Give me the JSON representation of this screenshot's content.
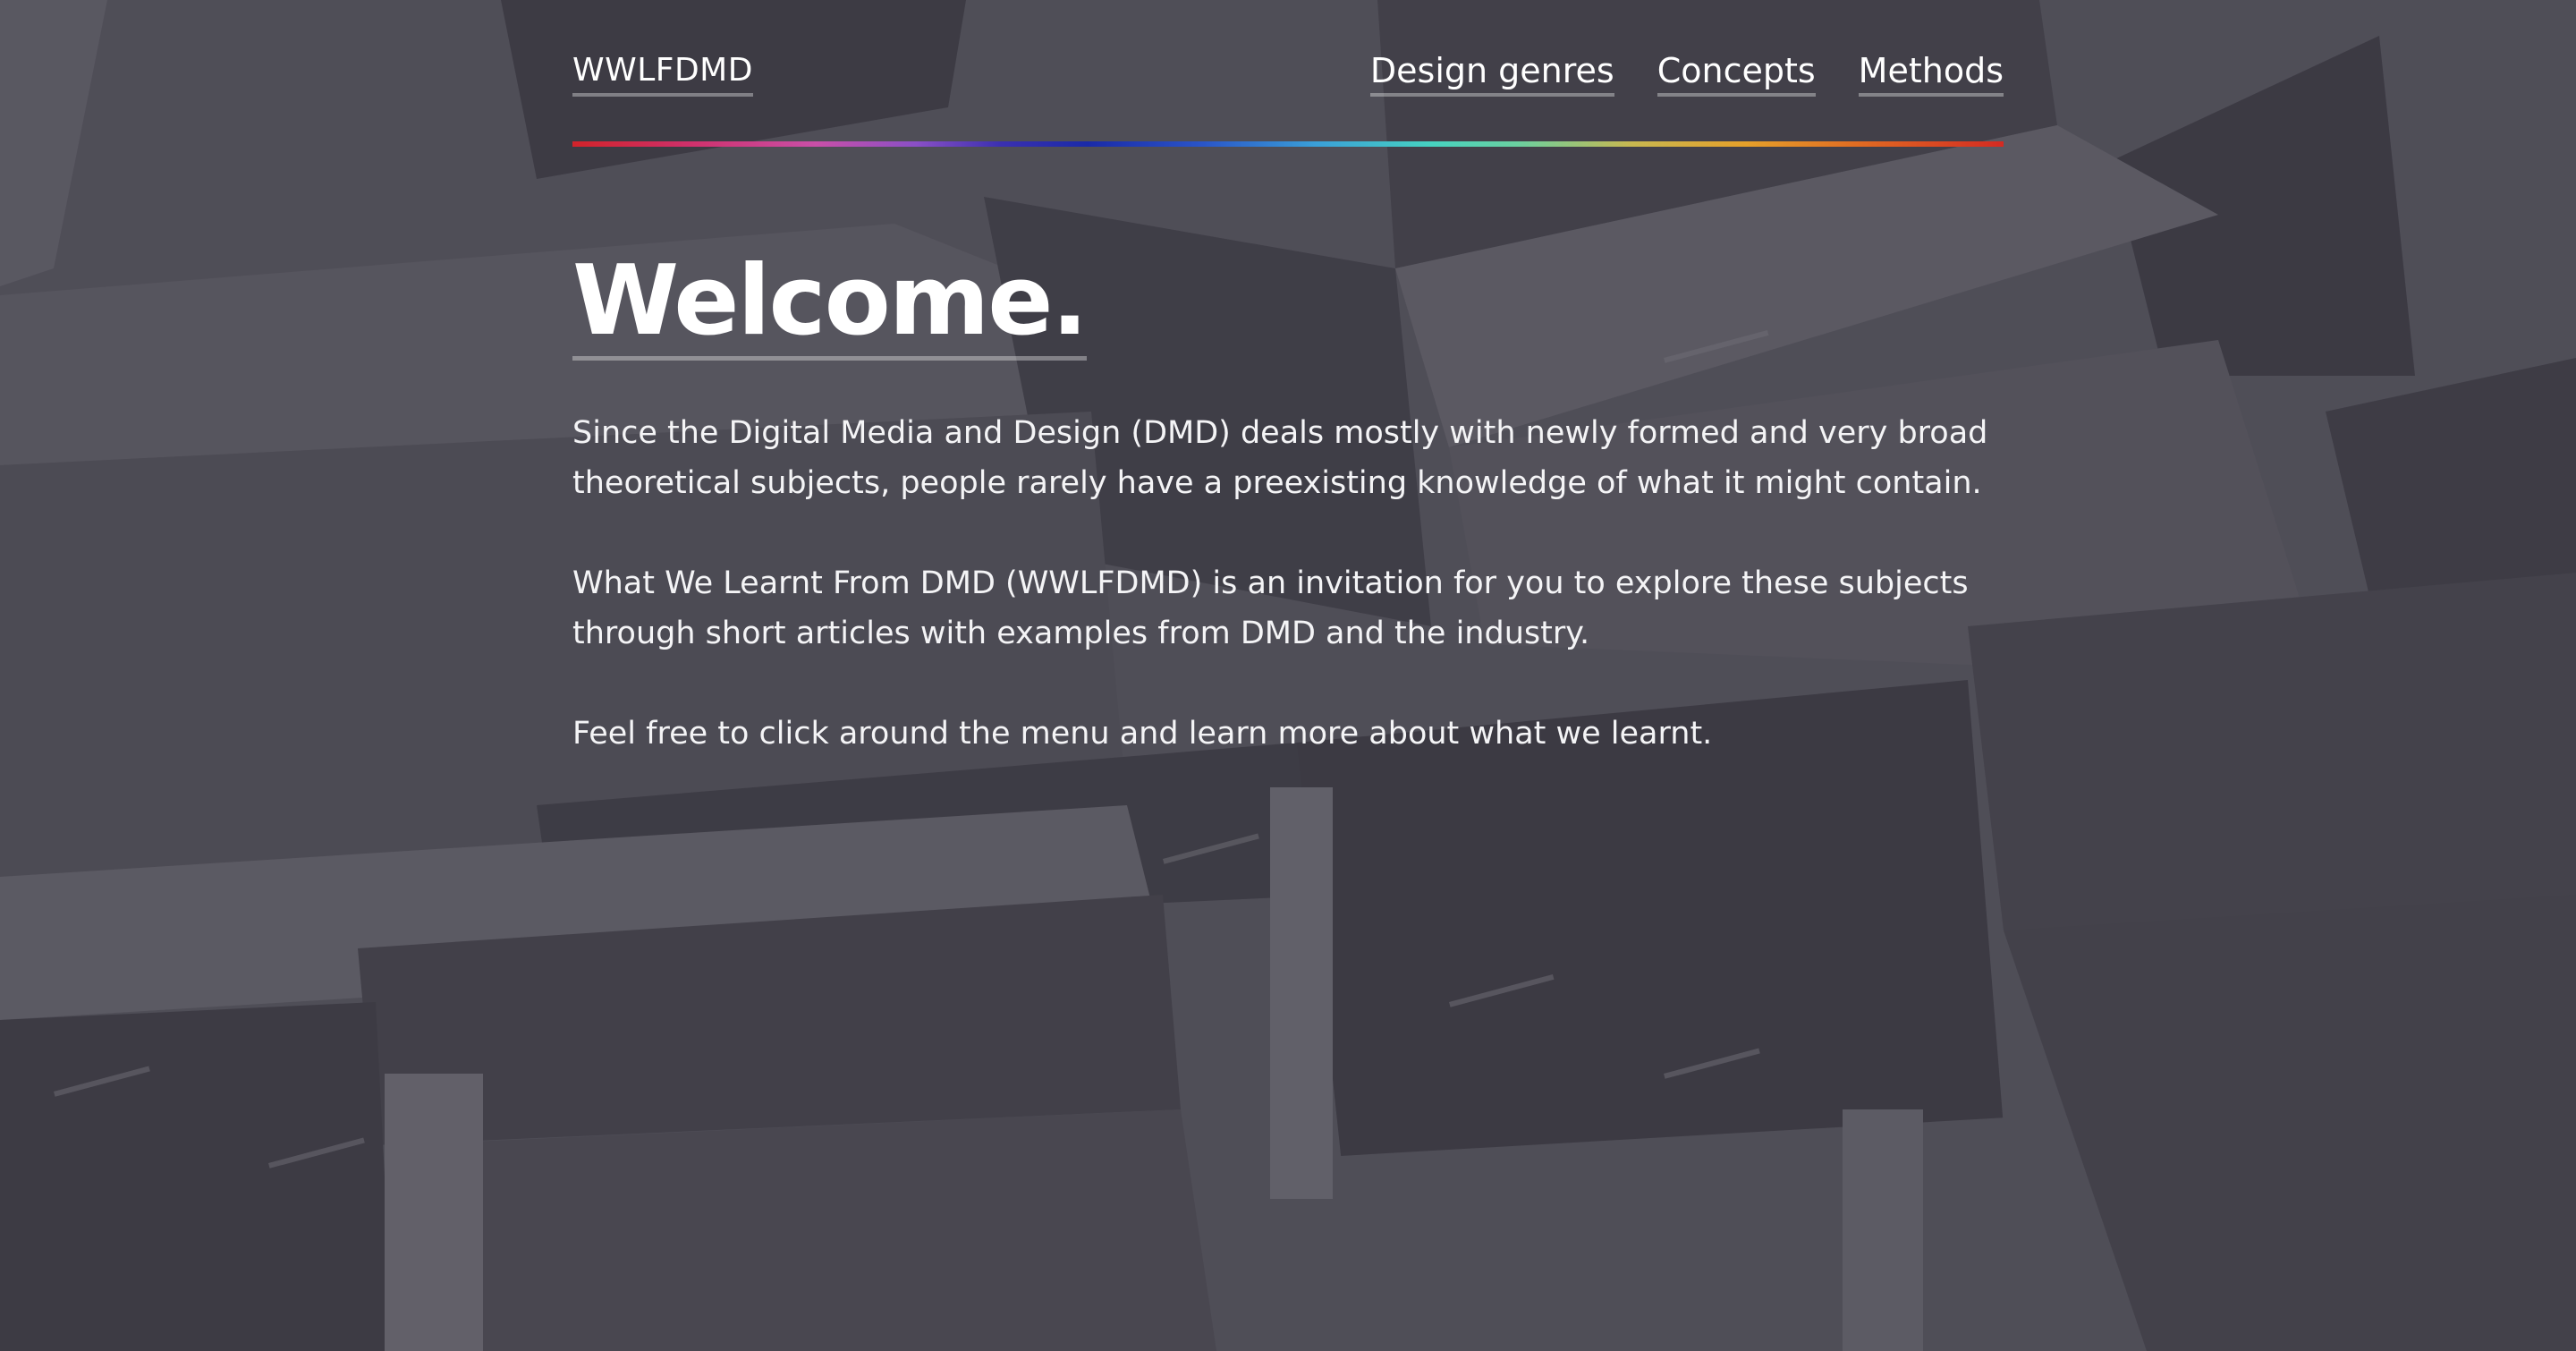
{
  "site": {
    "logo": "WWLFDMD"
  },
  "nav": {
    "items": [
      {
        "label": "Design genres"
      },
      {
        "label": "Concepts"
      },
      {
        "label": "Methods"
      }
    ]
  },
  "main": {
    "title": "Welcome.",
    "paragraphs": [
      "Since the Digital Media and Design (DMD) deals mostly with newly formed and very broad theoretical subjects, people rarely have a preexisting knowledge of what it might contain.",
      "What We Learnt From DMD (WWLFDMD) is an invitation for you to explore these subjects through short articles with examples from DMD and the industry.",
      "Feel free to click around the menu and learn more about what we learnt."
    ]
  },
  "colors": {
    "accent_gradient": [
      "#d2232a",
      "#c94fa8",
      "#1a2aa8",
      "#46d2c0",
      "#e5a02a",
      "#d42a22"
    ],
    "text": "#ffffff",
    "overlay": "#3e3c48"
  }
}
